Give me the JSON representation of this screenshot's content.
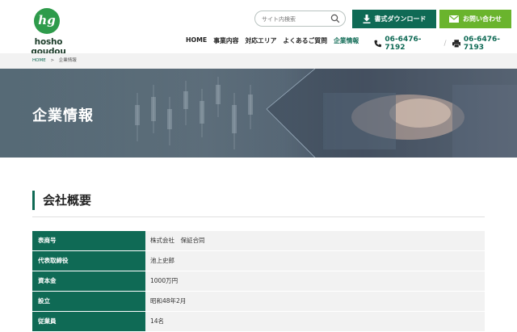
{
  "header": {
    "logo_mark": "hg",
    "logo_text": "hosho goudou",
    "search_placeholder": "サイト内検索",
    "download_label": "書式ダウンロード",
    "contact_label": "お問い合わせ",
    "nav": [
      "HOME",
      "事業内容",
      "対応エリア",
      "よくあるご質問",
      "企業情報"
    ],
    "nav_active": "企業情報",
    "tel": "06-6476-7192",
    "fax": "06-6476-7193",
    "colors": {
      "primary": "#0f6a55",
      "accent_green": "#6ab42d"
    }
  },
  "breadcrumb": {
    "home": "HOME",
    "separator": ">",
    "current": "企業情報"
  },
  "hero": {
    "title": "企業情報"
  },
  "section": {
    "title": "会社概要"
  },
  "company_table": [
    {
      "label": "表商号",
      "value": "株式会社　保証合同"
    },
    {
      "label": "代表取締役",
      "value": "池上史郎"
    },
    {
      "label": "資本金",
      "value": "1000万円"
    },
    {
      "label": "設立",
      "value": "昭和48年2月"
    },
    {
      "label": "従業員",
      "value": "14名"
    }
  ]
}
